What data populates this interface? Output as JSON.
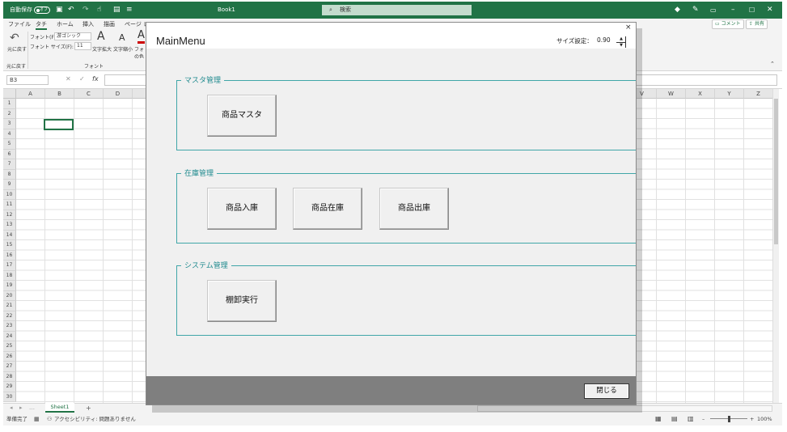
{
  "titlebar": {
    "autosave_label": "自動保存",
    "autosave_state": "オフ",
    "filename": "Book1",
    "search_placeholder": "検索",
    "colors": {
      "excel_green": "#217346"
    }
  },
  "ribbon": {
    "tabs": [
      "ファイル",
      "タチ",
      "ホーム",
      "挿入",
      "描画",
      "ページ レ"
    ],
    "undo_label": "元に戻す",
    "undo_group": "元に戻す",
    "font_name_label": "フォント(F):",
    "font_name_value": "游ゴシック",
    "font_size_label": "フォント サイズ(F):",
    "font_size_value": "11",
    "grow_label": "文字拡大",
    "shrink_label": "文字縮小",
    "font_color_label": "フォ の色",
    "font_group": "フォント",
    "comment_button": "コメント",
    "share_button": "共有"
  },
  "formula_bar": {
    "name_box": "B3",
    "fx": "fx"
  },
  "grid": {
    "columns": [
      "A",
      "B",
      "C",
      "D",
      "",
      "",
      "",
      "",
      "",
      "",
      "",
      "",
      "",
      "",
      "",
      "",
      "",
      "",
      "",
      "",
      "",
      "V",
      "W",
      "X",
      "Y",
      "Z"
    ],
    "rows": [
      "1",
      "2",
      "3",
      "4",
      "5",
      "6",
      "7",
      "8",
      "9",
      "10",
      "11",
      "12",
      "13",
      "14",
      "15",
      "16",
      "17",
      "18",
      "19",
      "20",
      "21",
      "22",
      "23",
      "24",
      "25",
      "26",
      "27",
      "28",
      "29",
      "30"
    ]
  },
  "sheets": {
    "tabs": [
      "Sheet1"
    ],
    "add": "+"
  },
  "statusbar": {
    "ready": "準備完了",
    "accessibility": "アクセシビリティ: 問題ありません",
    "zoom": "100%"
  },
  "dialog": {
    "title": "MainMenu",
    "close_x": "×",
    "size_label": "サイズ設定：",
    "size_value": "0.90",
    "groups": [
      {
        "legend": "マスタ管理",
        "buttons": [
          "商品マスタ"
        ]
      },
      {
        "legend": "在庫管理",
        "buttons": [
          "商品入庫",
          "商品在庫",
          "商品出庫"
        ]
      },
      {
        "legend": "システム管理",
        "buttons": [
          "棚卸実行"
        ]
      }
    ],
    "close_button": "閉じる",
    "colors": {
      "frame_accent": "#40a6a8",
      "footer": "#7f7f7f",
      "body": "#f0f0f0"
    }
  }
}
